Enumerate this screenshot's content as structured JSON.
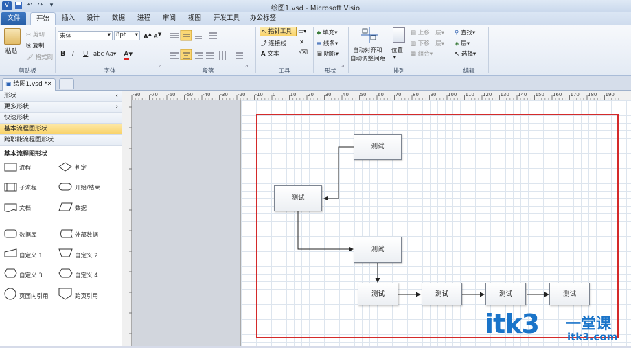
{
  "title": "绘图1.vsd - Microsoft Visio",
  "tabs": [
    "文件",
    "开始",
    "插入",
    "设计",
    "数据",
    "进程",
    "审阅",
    "视图",
    "开发工具",
    "办公标签"
  ],
  "clipboard": {
    "paste": "粘贴",
    "cut": "剪切",
    "copy": "复制",
    "format_painter": "格式刷",
    "label": "剪贴板"
  },
  "font": {
    "name": "宋体",
    "size": "8pt",
    "label": "字体"
  },
  "paragraph": {
    "label": "段落"
  },
  "tools": {
    "pointer": "指针工具",
    "connector": "连接线",
    "text": "文本",
    "label": "工具"
  },
  "shape": {
    "fill": "填充",
    "line": "线条",
    "shadow": "阴影",
    "label": "形状"
  },
  "arrange": {
    "auto_align": "自动对齐和",
    "auto_space": "自动调整间距",
    "position": "位置",
    "bring_forward": "上移一层",
    "send_backward": "下移一层",
    "group": "组合",
    "label": "排列"
  },
  "editing": {
    "find": "查找",
    "layers": "层",
    "select": "选择",
    "label": "编辑"
  },
  "doc_tab": "绘图1.vsd *",
  "shapes_panel": {
    "header": "形状",
    "more": "更多形状",
    "quick": "快速形状",
    "basic_flowchart": "基本流程图形状",
    "cross_functional": "跨职能流程图形状",
    "section_title": "基本流程图形状",
    "items": [
      "流程",
      "判定",
      "子流程",
      "开始/结束",
      "文档",
      "数据",
      "数据库",
      "外部数据",
      "自定义 1",
      "自定义 2",
      "自定义 3",
      "自定义 4",
      "页面内引用",
      "跨页引用"
    ]
  },
  "ruler_ticks": [
    "-80",
    "-70",
    "-60",
    "-50",
    "-40",
    "-30",
    "-20",
    "-10",
    "0",
    "10",
    "20",
    "30",
    "40",
    "50",
    "60",
    "70",
    "80",
    "90",
    "100",
    "110",
    "120",
    "130",
    "140",
    "150",
    "160",
    "170",
    "180",
    "190"
  ],
  "diagram": {
    "boxes": [
      "测试",
      "测试",
      "测试",
      "测试",
      "测试",
      "测试",
      "测试"
    ]
  },
  "watermark": {
    "text": "itk3",
    "cn": "一堂课",
    "url": "itk3.com"
  }
}
